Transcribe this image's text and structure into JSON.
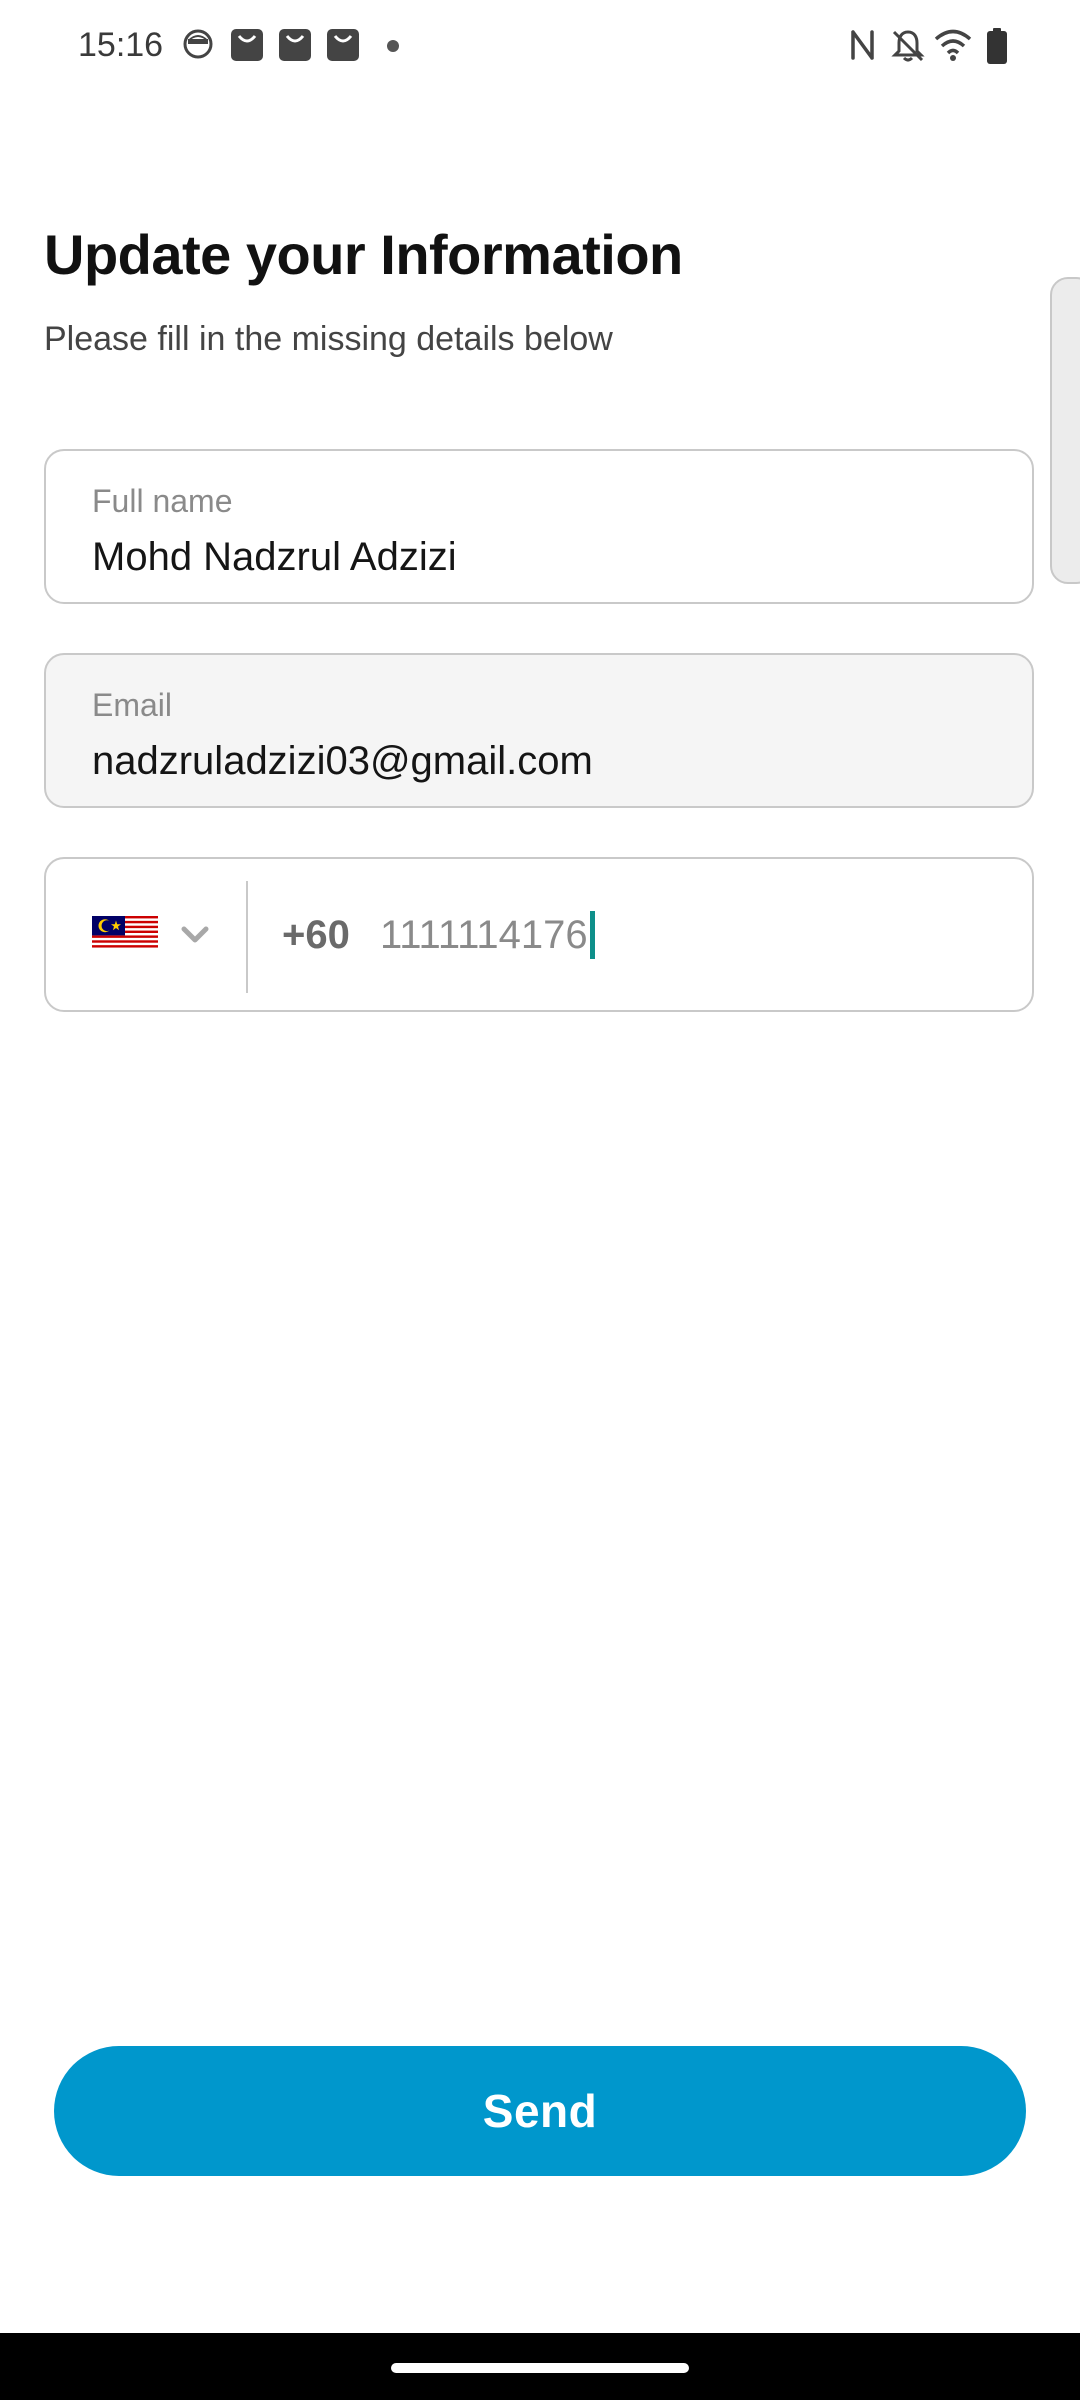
{
  "status_bar": {
    "time": "15:16",
    "icons": [
      "face-notification-icon",
      "shopping-bag-icon",
      "shopping-bag-icon",
      "shopping-bag-icon",
      "more-notifications-dot",
      "nfc-icon",
      "bell-off-icon",
      "wifi-icon",
      "battery-icon"
    ]
  },
  "header": {
    "title": "Update your Information",
    "subtitle": "Please fill in the missing details below"
  },
  "form": {
    "full_name": {
      "label": "Full name",
      "value": "Mohd Nadzrul Adzizi"
    },
    "email": {
      "label": "Email",
      "value": "nadzruladzizi03@gmail.com"
    },
    "phone": {
      "country_flag": "malaysia-flag-icon",
      "dial_code": "+60",
      "value": "1111114176"
    }
  },
  "actions": {
    "send_label": "Send"
  },
  "colors": {
    "primary": "#0097cc",
    "caret": "#0e8f8a",
    "border": "#c9c9c9",
    "disabled_bg": "#f5f5f5"
  }
}
